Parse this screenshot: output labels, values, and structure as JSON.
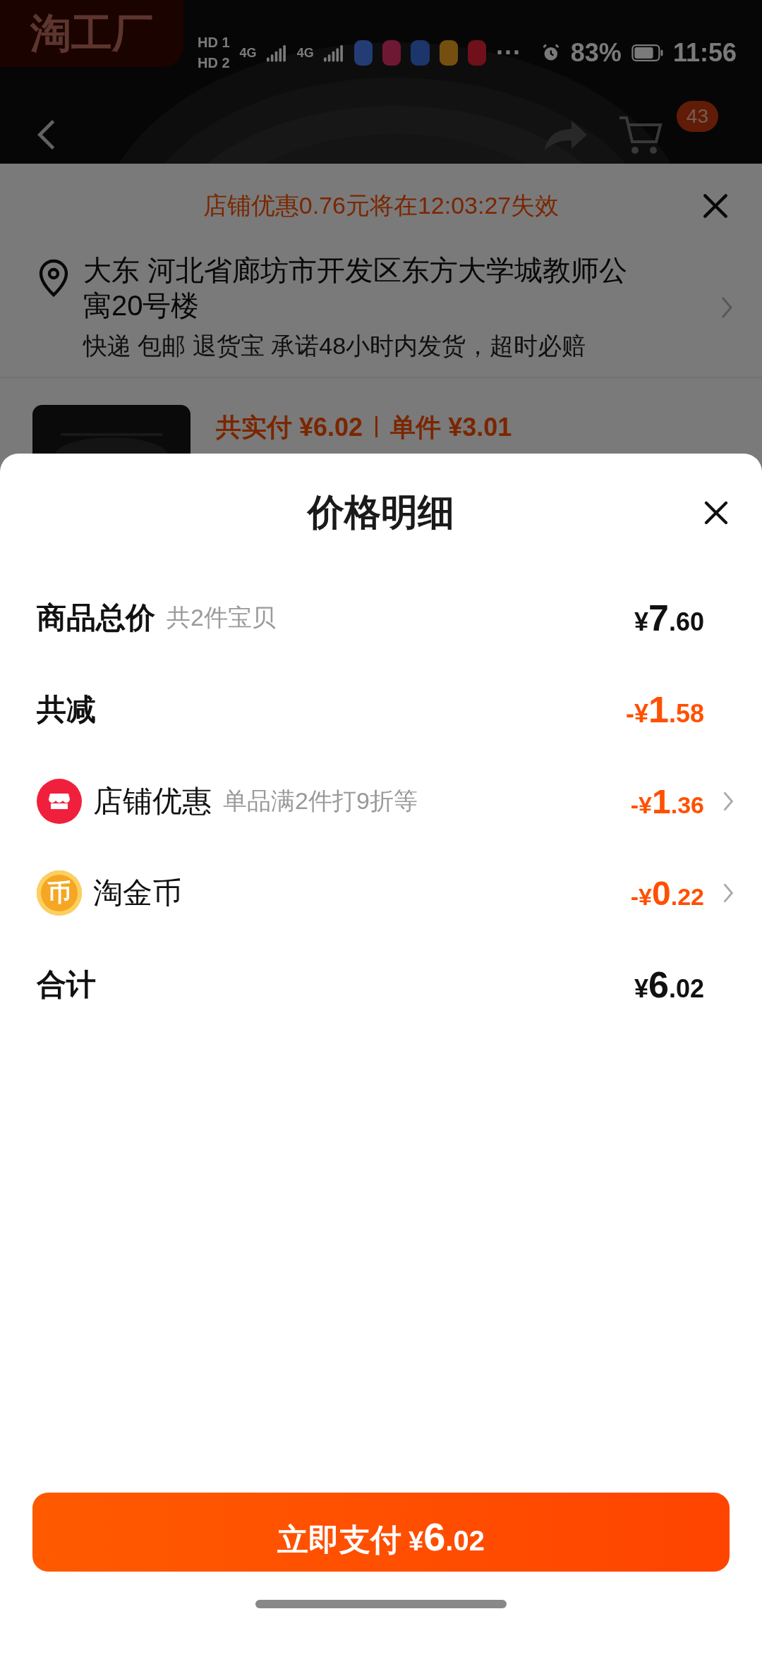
{
  "status_bar": {
    "sims": [
      {
        "label": "HD",
        "slot": "1"
      },
      {
        "label": "HD",
        "slot": "2"
      }
    ],
    "networks": [
      "4G",
      "4G"
    ],
    "more": "···",
    "battery": "83%",
    "time": "11:56"
  },
  "background": {
    "brand": "淘工厂",
    "cart_badge": "43",
    "promo_notice": "店铺优惠0.76元将在12:03:27失效",
    "address": "大东 河北省廊坊市开发区东方大学城教师公寓20号楼",
    "delivery": "快递 包邮 退货宝 承诺48小时内发货，超时必赔",
    "product": {
      "total_label": "共实付",
      "total": "¥6.02",
      "unit_label": "单件",
      "unit_price": "¥3.01"
    }
  },
  "sheet": {
    "title": "价格明细",
    "rows": [
      {
        "kind": "header",
        "label": "商品总价",
        "note": "共2件宝贝",
        "amount": "¥7.60",
        "discount": false
      },
      {
        "kind": "header",
        "label": "共减",
        "amount": "-¥1.58",
        "discount": true
      },
      {
        "kind": "store",
        "label": "店铺优惠",
        "note": "单品满2件打9折等",
        "amount": "-¥1.36",
        "discount": true
      },
      {
        "kind": "coin",
        "icon_text": "币",
        "label": "淘金币",
        "amount": "-¥0.22",
        "discount": true
      },
      {
        "kind": "header",
        "label": "合计",
        "amount": "¥6.02",
        "discount": false
      }
    ],
    "pay_button": {
      "label": "立即支付",
      "amount": "¥6.02"
    }
  }
}
